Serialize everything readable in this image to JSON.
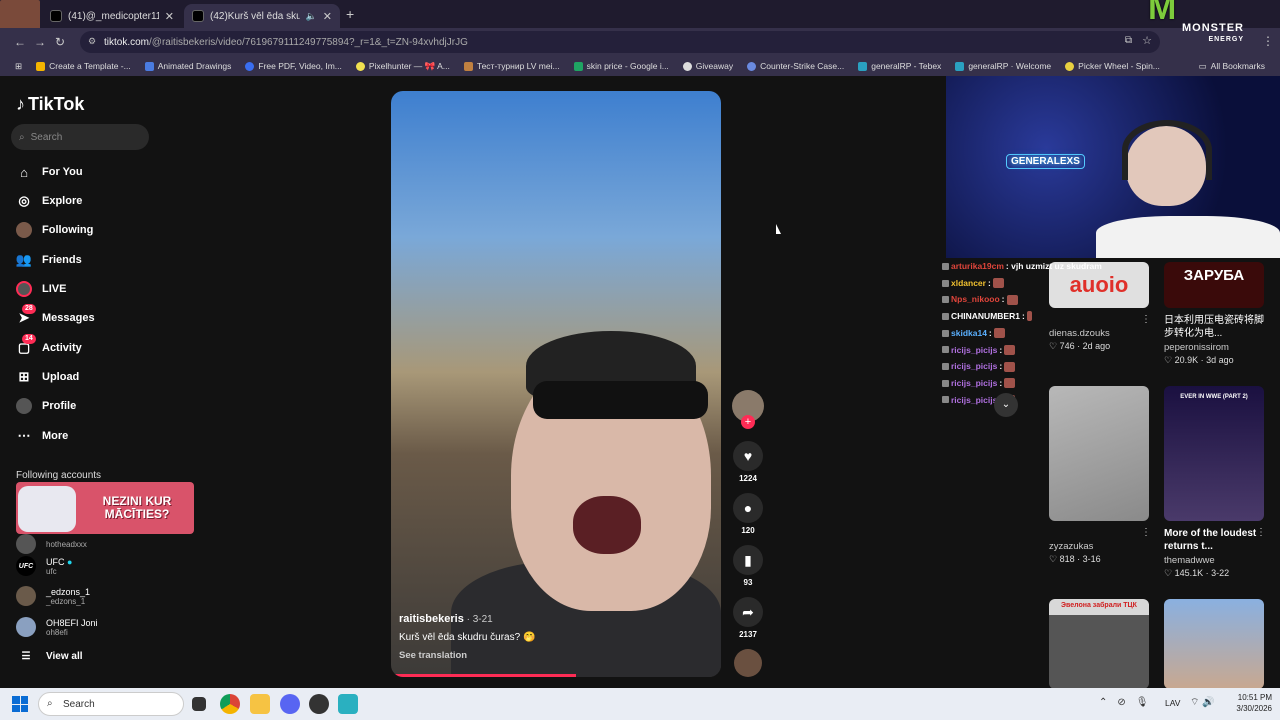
{
  "browser": {
    "tabs": [
      {
        "title": "(41)@_medicopter117_ #medic",
        "active": false
      },
      {
        "title": "(42)Kurš vēl ēda skudru čura",
        "active": true
      }
    ],
    "url_host": "tiktok.com",
    "url_path": "/@raitisbekeris/video/7619679111249775894?_r=1&_t=ZN-94xvhdjJrJG",
    "bookmarks": [
      "Create a Template -...",
      "Animated Drawings",
      "Free PDF, Video, Im...",
      "Pixelhunter — 🎀 A...",
      "Тест-турнир LV mei...",
      "skin price - Google i...",
      "Giveaway",
      "Counter-Strike Case...",
      "generalRP - Tebex",
      "generalRP · Welcome",
      "Picker Wheel - Spin..."
    ],
    "all_bookmarks": "All Bookmarks"
  },
  "tiktok": {
    "logo": "TikTok",
    "search_placeholder": "Search",
    "nav": [
      {
        "label": "For You",
        "icon": "home-icon",
        "badge": ""
      },
      {
        "label": "Explore",
        "icon": "compass-icon",
        "badge": ""
      },
      {
        "label": "Following",
        "icon": "following-avatar-icon",
        "badge": ""
      },
      {
        "label": "Friends",
        "icon": "friends-icon",
        "badge": ""
      },
      {
        "label": "LIVE",
        "icon": "live-icon",
        "badge": ""
      },
      {
        "label": "Messages",
        "icon": "messages-icon",
        "badge": "28"
      },
      {
        "label": "Activity",
        "icon": "activity-icon",
        "badge": "14"
      },
      {
        "label": "Upload",
        "icon": "upload-icon",
        "badge": ""
      },
      {
        "label": "Profile",
        "icon": "profile-avatar-icon",
        "badge": ""
      },
      {
        "label": "More",
        "icon": "more-icon",
        "badge": ""
      }
    ],
    "following_title": "Following accounts",
    "promo": "NEZINI KUR MĀCĪTIES?",
    "accounts": [
      {
        "name": "",
        "user": "hotheadxxx",
        "avatar": ""
      },
      {
        "name": "UFC",
        "user": "ufc",
        "avatar": "UFC"
      },
      {
        "name": "_edzons_1",
        "user": "_edzons_1",
        "avatar": ""
      },
      {
        "name": "OH8EFI Joni",
        "user": "oh8efi",
        "avatar": ""
      }
    ],
    "view_all": "View all"
  },
  "video": {
    "author": "raitisbekeris",
    "date": "· 3-21",
    "caption": "Kurš vēl ēda skudru čuras? 🤭",
    "see_translation": "See translation",
    "progress": 0.56,
    "likes": "1224",
    "comments": "120",
    "saves": "93",
    "shares": "2137"
  },
  "chat": [
    {
      "user": "arturika19cm",
      "text": ": vjh uzmizt uz skudram",
      "color": "#e0453b"
    },
    {
      "user": "xldancer",
      "text": ":",
      "color": "#f0c030"
    },
    {
      "user": "Nps_nikooo",
      "text": ":",
      "color": "#e0453b"
    },
    {
      "user": "CHINANUMBER1",
      "text": ":",
      "color": "#ffffff"
    },
    {
      "user": "skidka14",
      "text": ":",
      "color": "#5ab0ff"
    },
    {
      "user": "ricijs_picijs",
      "text": ":",
      "color": "#b070e0"
    },
    {
      "user": "ricijs_picijs",
      "text": ":",
      "color": "#b070e0"
    },
    {
      "user": "ricijs_picijs",
      "text": ":",
      "color": "#b070e0"
    },
    {
      "user": "ricijs_picijs",
      "text": ":",
      "color": "#b070e0"
    }
  ],
  "webcam_sign": "GENERALEXS",
  "grid": [
    {
      "title": "",
      "user": "dienas.dzouks",
      "likes": "746",
      "date": "2d ago",
      "thumb_text": "auoio"
    },
    {
      "title": "日本利用压电瓷砖将脚步转化为电...",
      "user": "peperonissirom",
      "likes": "20.9K",
      "date": "3d ago",
      "thumb_text": "ЗАРУБА"
    },
    {
      "title": "",
      "user": "zyzazukas",
      "likes": "818",
      "date": "3-16",
      "thumb_text": ""
    },
    {
      "title": "More of the loudest returns t...",
      "user": "themadwwe",
      "likes": "145.1K",
      "date": "3-22",
      "thumb_text": "EVER IN WWE (PART 2)"
    },
    {
      "title": "",
      "user": "",
      "likes": "",
      "date": "",
      "thumb_text": "Эвелона забрали ТЦК"
    },
    {
      "title": "",
      "user": "",
      "likes": "",
      "date": "",
      "thumb_text": ""
    }
  ],
  "taskbar": {
    "search": "Search",
    "lang": "LAV",
    "time": "10:51 PM",
    "date": "3/30/2026"
  },
  "overlay": {
    "brand_line1": "MONSTER",
    "brand_line2": "ENERGY"
  }
}
